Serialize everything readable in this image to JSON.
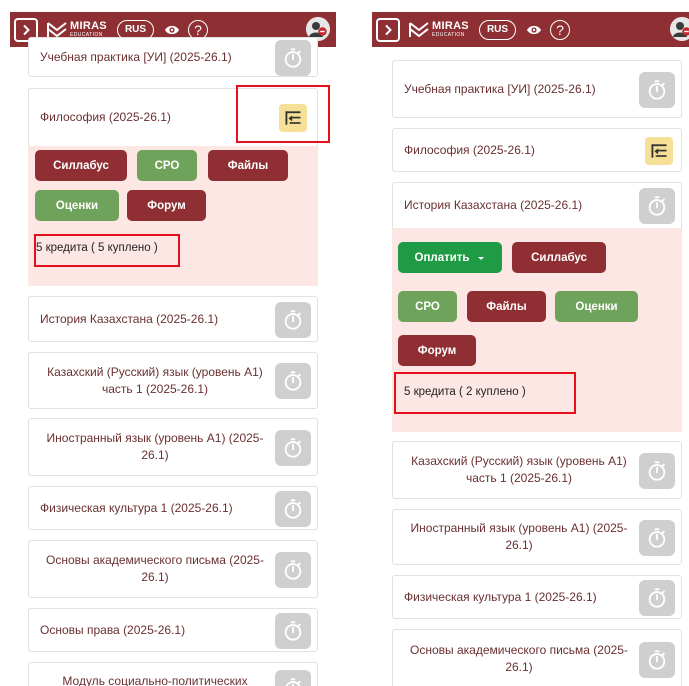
{
  "header": {
    "logo_main": "MIRAS",
    "logo_sub": "EDUCATION",
    "lang": "RUS",
    "help": "?"
  },
  "left": {
    "courses": [
      {
        "title": "Учебная практика [УИ] (2025-26.1)"
      },
      {
        "title": "Философия (2025-26.1)"
      },
      {
        "title": "История Казахстана (2025-26.1)"
      },
      {
        "title": "Казахский (Русский) язык (уровень А1) часть 1 (2025-26.1)"
      },
      {
        "title": "Иностранный язык (уровень А1) (2025-26.1)"
      },
      {
        "title": "Физическая культура 1 (2025-26.1)"
      },
      {
        "title": "Основы академического письма (2025-26.1)"
      },
      {
        "title": "Основы права (2025-26.1)"
      },
      {
        "title": "Модуль социально-политических"
      }
    ],
    "buttons": {
      "syllabus": "Силлабус",
      "sro": "СРО",
      "files": "Файлы",
      "grades": "Оценки",
      "forum": "Форум"
    },
    "credits": "5 кредита ( 5 куплено )"
  },
  "right": {
    "courses": [
      {
        "title": "Учебная практика [УИ] (2025-26.1)"
      },
      {
        "title": "Философия (2025-26.1)"
      },
      {
        "title": "История Казахстана (2025-26.1)"
      },
      {
        "title": "Казахский (Русский) язык (уровень А1) часть 1 (2025-26.1)"
      },
      {
        "title": "Иностранный язык (уровень А1) (2025-26.1)"
      },
      {
        "title": "Физическая культура 1 (2025-26.1)"
      },
      {
        "title": "Основы академического письма (2025-26.1)"
      }
    ],
    "buttons": {
      "pay": "Оплатить",
      "syllabus": "Силлабус",
      "sro": "СРО",
      "files": "Файлы",
      "grades": "Оценки",
      "forum": "Форум"
    },
    "credits": "5 кредита ( 2 куплено )"
  }
}
